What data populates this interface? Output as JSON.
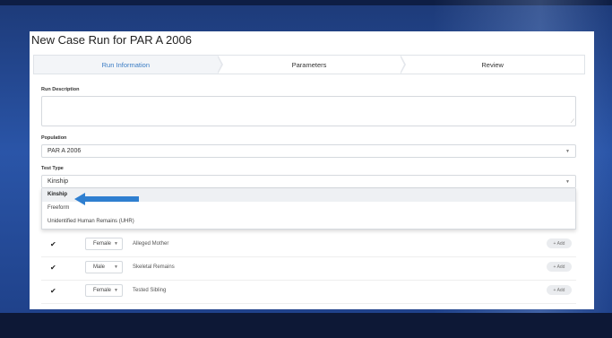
{
  "title": "New Case Run for PAR A 2006",
  "steps": [
    "Run Information",
    "Parameters",
    "Review"
  ],
  "form": {
    "run_description_label": "Run Description",
    "population_label": "Population",
    "population_value": "PAR A 2006",
    "test_type_label": "Test Type",
    "test_type_value": "Kinship",
    "options": [
      "Kinship",
      "Freeform",
      "Unidentified Human Remains (UHR)"
    ]
  },
  "rows": [
    {
      "sex": "Female",
      "relation": "Alleged Mother",
      "add": "+ Add"
    },
    {
      "sex": "Male",
      "relation": "Skeletal Remains",
      "add": "+ Add"
    },
    {
      "sex": "Female",
      "relation": "Tested Sibling",
      "add": "+ Add"
    }
  ],
  "icons": {
    "checkbox": "checkmark-icon",
    "caret": "chevron-down-icon",
    "arrow": "pointer-arrow-icon"
  },
  "colors": {
    "accent": "#3a7cc4",
    "arrow": "#2f7fd0"
  }
}
